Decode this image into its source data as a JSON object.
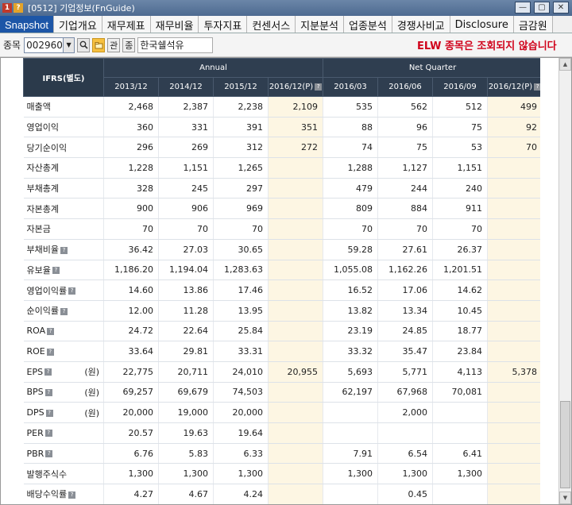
{
  "window": {
    "title": "[0512] 기업정보(FnGuide)",
    "icon_a": "1",
    "icon_b": "?",
    "minimize": "—",
    "restore": "▢",
    "close": "✕"
  },
  "tabs": [
    {
      "label": "Snapshot"
    },
    {
      "label": "기업개요"
    },
    {
      "label": "재무제표"
    },
    {
      "label": "재무비율"
    },
    {
      "label": "투자지표"
    },
    {
      "label": "컨센서스"
    },
    {
      "label": "지분분석"
    },
    {
      "label": "업종분석"
    },
    {
      "label": "경쟁사비교"
    },
    {
      "label": "Disclosure"
    },
    {
      "label": "금감원"
    }
  ],
  "toolbar": {
    "stock_label": "종목",
    "stock_code": "002960",
    "search_icon": "magnifier-icon",
    "folder_icon": "folder-icon",
    "related_label": "관",
    "extra_label": "종",
    "stock_name": "한국쉘석유",
    "notice": "ELW 종목은 조회되지 않습니다"
  },
  "table": {
    "header_main": "IFRS(별도)",
    "group_annual": "Annual",
    "group_quarter": "Net Quarter",
    "columns": [
      "2013/12",
      "2014/12",
      "2015/12",
      "2016/12(P)",
      "2016/03",
      "2016/06",
      "2016/09",
      "2016/12(P)"
    ],
    "rows": [
      {
        "label": "매출액",
        "unit": "",
        "info": false,
        "values": [
          "2,468",
          "2,387",
          "2,238",
          "2,109",
          "535",
          "562",
          "512",
          "499"
        ]
      },
      {
        "label": "영업이익",
        "unit": "",
        "info": false,
        "values": [
          "360",
          "331",
          "391",
          "351",
          "88",
          "96",
          "75",
          "92"
        ]
      },
      {
        "label": "당기순이익",
        "unit": "",
        "info": false,
        "values": [
          "296",
          "269",
          "312",
          "272",
          "74",
          "75",
          "53",
          "70"
        ]
      },
      {
        "label": "자산총계",
        "unit": "",
        "info": false,
        "values": [
          "1,228",
          "1,151",
          "1,265",
          "",
          "1,288",
          "1,127",
          "1,151",
          ""
        ]
      },
      {
        "label": "부채총계",
        "unit": "",
        "info": false,
        "values": [
          "328",
          "245",
          "297",
          "",
          "479",
          "244",
          "240",
          ""
        ]
      },
      {
        "label": "자본총계",
        "unit": "",
        "info": false,
        "values": [
          "900",
          "906",
          "969",
          "",
          "809",
          "884",
          "911",
          ""
        ]
      },
      {
        "label": "자본금",
        "unit": "",
        "info": false,
        "values": [
          "70",
          "70",
          "70",
          "",
          "70",
          "70",
          "70",
          ""
        ]
      },
      {
        "label": "부채비율",
        "unit": "",
        "info": true,
        "values": [
          "36.42",
          "27.03",
          "30.65",
          "",
          "59.28",
          "27.61",
          "26.37",
          ""
        ]
      },
      {
        "label": "유보율",
        "unit": "",
        "info": true,
        "values": [
          "1,186.20",
          "1,194.04",
          "1,283.63",
          "",
          "1,055.08",
          "1,162.26",
          "1,201.51",
          ""
        ]
      },
      {
        "label": "영업이익률",
        "unit": "",
        "info": true,
        "values": [
          "14.60",
          "13.86",
          "17.46",
          "",
          "16.52",
          "17.06",
          "14.62",
          ""
        ]
      },
      {
        "label": "순이익률",
        "unit": "",
        "info": true,
        "values": [
          "12.00",
          "11.28",
          "13.95",
          "",
          "13.82",
          "13.34",
          "10.45",
          ""
        ]
      },
      {
        "label": "ROA",
        "unit": "",
        "info": true,
        "values": [
          "24.72",
          "22.64",
          "25.84",
          "",
          "23.19",
          "24.85",
          "18.77",
          ""
        ]
      },
      {
        "label": "ROE",
        "unit": "",
        "info": true,
        "values": [
          "33.64",
          "29.81",
          "33.31",
          "",
          "33.32",
          "35.47",
          "23.84",
          ""
        ]
      },
      {
        "label": "EPS",
        "unit": "(원)",
        "info": true,
        "values": [
          "22,775",
          "20,711",
          "24,010",
          "20,955",
          "5,693",
          "5,771",
          "4,113",
          "5,378"
        ]
      },
      {
        "label": "BPS",
        "unit": "(원)",
        "info": true,
        "values": [
          "69,257",
          "69,679",
          "74,503",
          "",
          "62,197",
          "67,968",
          "70,081",
          ""
        ]
      },
      {
        "label": "DPS",
        "unit": "(원)",
        "info": true,
        "values": [
          "20,000",
          "19,000",
          "20,000",
          "",
          "",
          "2,000",
          "",
          ""
        ]
      },
      {
        "label": "PER",
        "unit": "",
        "info": true,
        "values": [
          "20.57",
          "19.63",
          "19.64",
          "",
          "",
          "",
          "",
          ""
        ]
      },
      {
        "label": "PBR",
        "unit": "",
        "info": true,
        "values": [
          "6.76",
          "5.83",
          "6.33",
          "",
          "7.91",
          "6.54",
          "6.41",
          ""
        ]
      },
      {
        "label": "발행주식수",
        "unit": "",
        "info": false,
        "values": [
          "1,300",
          "1,300",
          "1,300",
          "",
          "1,300",
          "1,300",
          "1,300",
          ""
        ]
      },
      {
        "label": "배당수익률",
        "unit": "",
        "info": true,
        "values": [
          "4.27",
          "4.67",
          "4.24",
          "",
          "",
          "0.45",
          "",
          ""
        ]
      }
    ]
  },
  "colors": {
    "header_bg": "#2f3e50",
    "estimate_bg": "#fdf6e3",
    "active_tab": "#1d56a7",
    "notice": "#d0021b"
  }
}
